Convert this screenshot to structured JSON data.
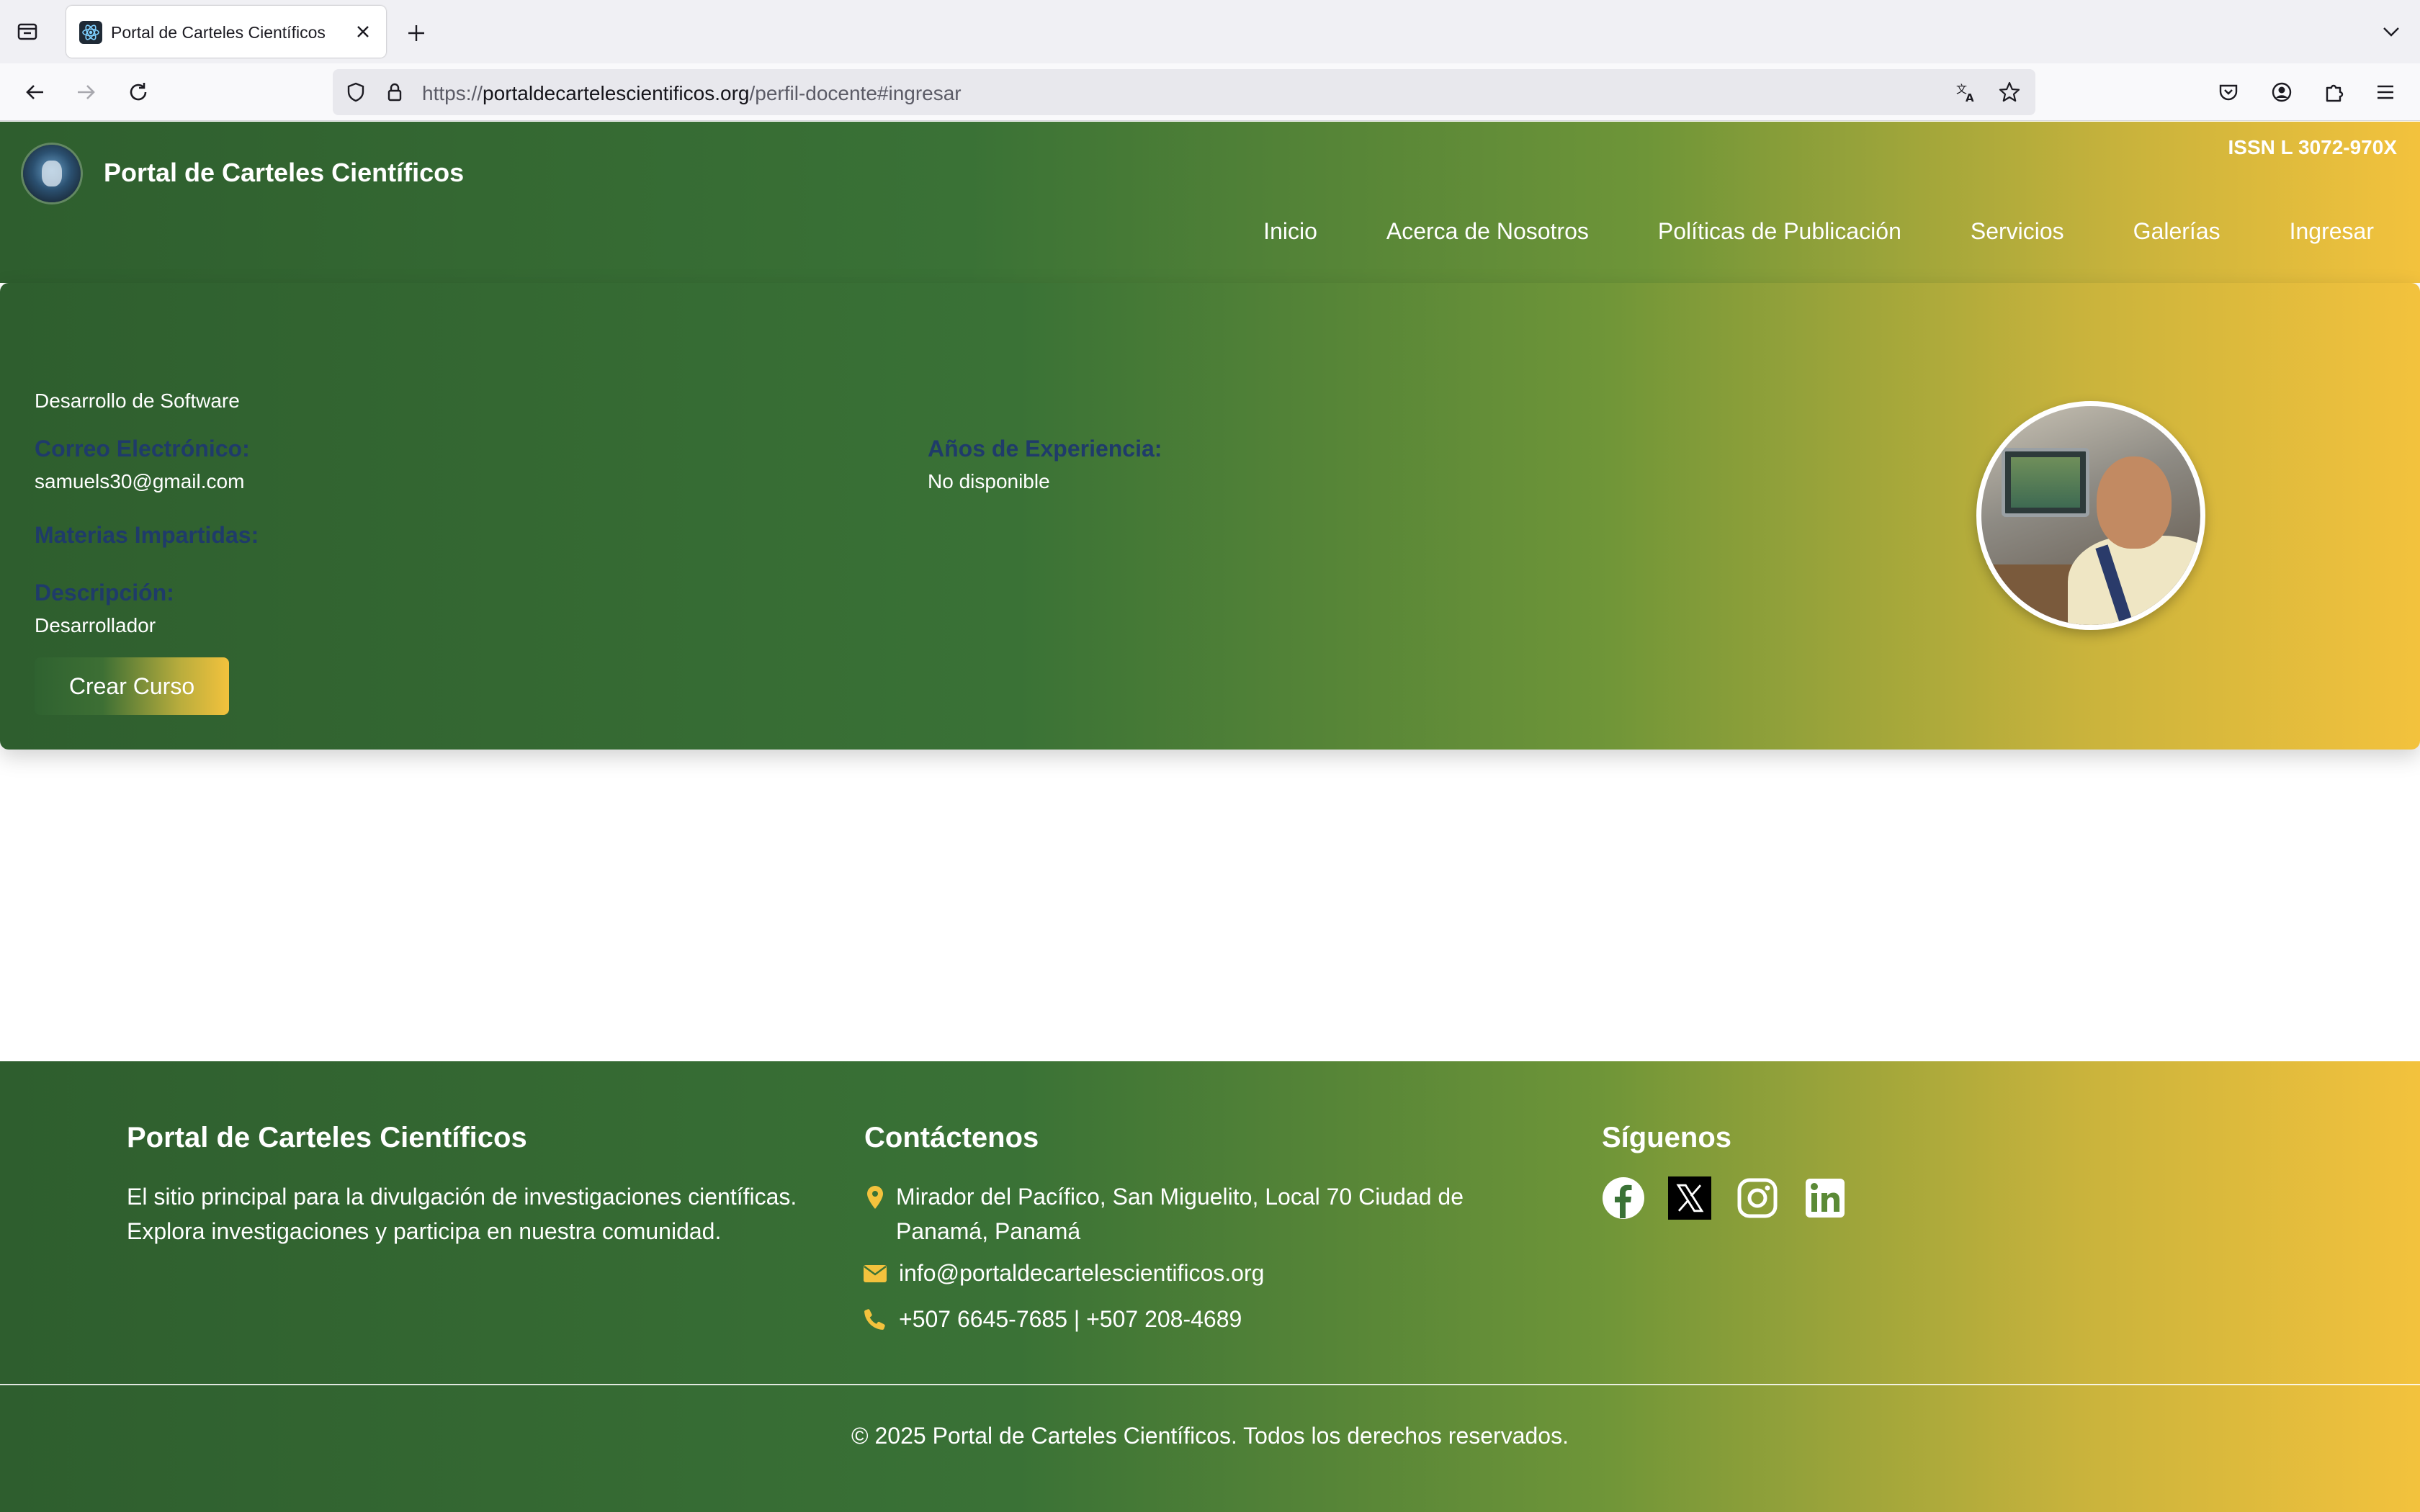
{
  "browser": {
    "tab_title": "Portal de Carteles Científicos",
    "url_prefix": "https://",
    "url_host": "portaldecartelescientificos.org",
    "url_path": "/perfil-docente#ingresar"
  },
  "header": {
    "site_title": "Portal de Carteles Científicos",
    "issn": "ISSN L 3072-970X",
    "menu": [
      "Inicio",
      "Acerca de Nosotros",
      "Políticas de Publicación",
      "Servicios",
      "Galerías",
      "Ingresar"
    ]
  },
  "profile": {
    "department": "Desarrollo de Software",
    "email_label": "Correo Electrónico:",
    "email_value": "samuels30@gmail.com",
    "experience_label": "Años de Experiencia:",
    "experience_value": "No disponible",
    "subjects_label": "Materias Impartidas:",
    "description_label": "Descripción:",
    "description_value": "Desarrollador",
    "create_course_label": "Crear Curso"
  },
  "footer": {
    "about_title": "Portal de Carteles Científicos",
    "about_text_line1": "El sitio principal para la divulgación de investigaciones científicas.",
    "about_text_line2": "Explora investigaciones y participa en nuestra comunidad.",
    "contact_title": "Contáctenos",
    "address_line1": "Mirador del Pacífico, San Miguelito, Local 70 Ciudad de",
    "address_line2": "Panamá, Panamá",
    "email": "info@portaldecartelescientificos.org",
    "phone": "+507 6645-7685 | +507 208-4689",
    "follow_title": "Síguenos",
    "copyright": "© 2025 Portal de Carteles Científicos. Todos los derechos reservados."
  },
  "colors": {
    "gradient_start": "#2e5e2e",
    "gradient_end": "#f3c23d",
    "label_blue": "#1f3b6a",
    "contact_icon": "#f3c23d"
  }
}
